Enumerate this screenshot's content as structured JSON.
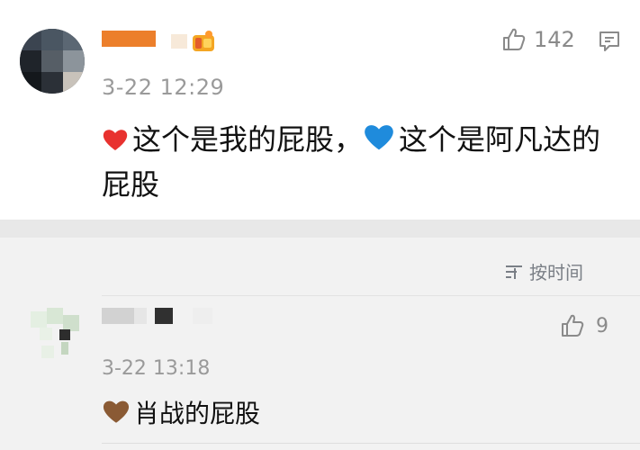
{
  "comment1": {
    "time": "3-22 12:29",
    "like_count": "142",
    "text_part1": "这个是我的屁股，",
    "text_part2": "这个是阿凡达的屁股",
    "heart1": "red",
    "heart2": "blue"
  },
  "sort": {
    "label": "按时间"
  },
  "comment2": {
    "time": "3-22 13:18",
    "like_count": "9",
    "text": "肖战的屁股",
    "heart": "brown"
  },
  "colors": {
    "username_orange": "#ec7f2b",
    "heart_red": "#e8322f",
    "heart_blue": "#1f8bdc",
    "heart_brown": "#8a5a34",
    "meta_gray": "#9a9a9a"
  }
}
